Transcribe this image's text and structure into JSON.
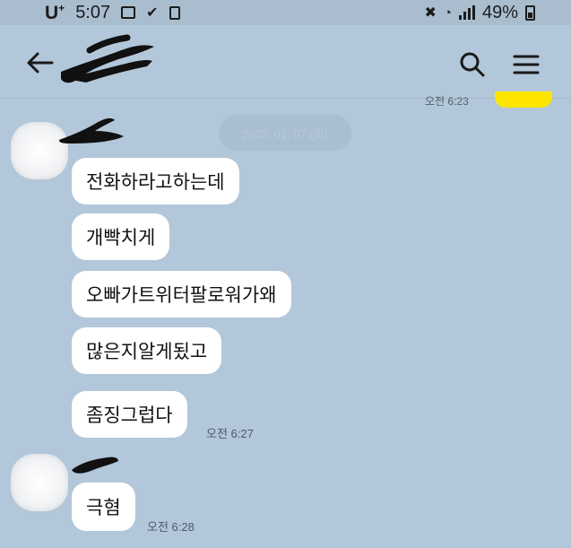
{
  "statusbar": {
    "carrier": "U",
    "carrier_sup": "+",
    "time": "5:07",
    "battery": "49%"
  },
  "header": {
    "title": "",
    "icons": [
      "back-arrow-icon",
      "search-icon",
      "menu-icon"
    ]
  },
  "previous": {
    "time_fragment": "오전 6:23"
  },
  "date_chip": "2020. 01. 07.(화)",
  "groups": [
    {
      "sender": "",
      "messages": [
        "전화하라고하는데",
        "개빡치게",
        "오빠가트위터팔로워가왜",
        "많은지알게됬고",
        "좀징그럽다"
      ],
      "time": "오전 6:27"
    },
    {
      "sender": "",
      "messages": [
        "극혐"
      ],
      "time": "오전 6:28"
    }
  ],
  "colors": {
    "background": "#b2c7d9",
    "bubble": "#ffffff",
    "own_bubble": "#fee500"
  }
}
